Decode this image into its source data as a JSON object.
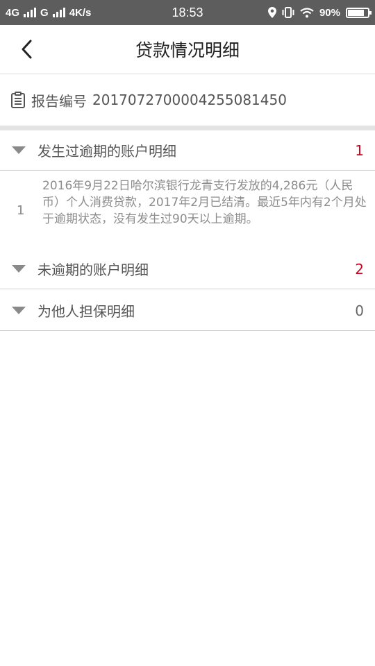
{
  "status_bar": {
    "network1": "4G",
    "network2": "G",
    "speed": "4K/s",
    "time": "18:53",
    "battery": "90%",
    "battery_level": 0.9
  },
  "header": {
    "title": "贷款情况明细"
  },
  "report": {
    "label": "报告编号",
    "number": "2017072700004255081450"
  },
  "sections": [
    {
      "title": "发生过逾期的账户明细",
      "count": "1",
      "count_color": "#d0021b",
      "items": [
        {
          "index": "1",
          "text": "2016年9月22日哈尔滨银行龙青支行发放的4,286元（人民币）个人消费贷款，2017年2月已结清。最近5年内有2个月处于逾期状态，没有发生过90天以上逾期。"
        }
      ]
    },
    {
      "title": "未逾期的账户明细",
      "count": "2",
      "count_color": "#d0021b"
    },
    {
      "title": "为他人担保明细",
      "count": "0",
      "count_color": "#666666"
    }
  ]
}
